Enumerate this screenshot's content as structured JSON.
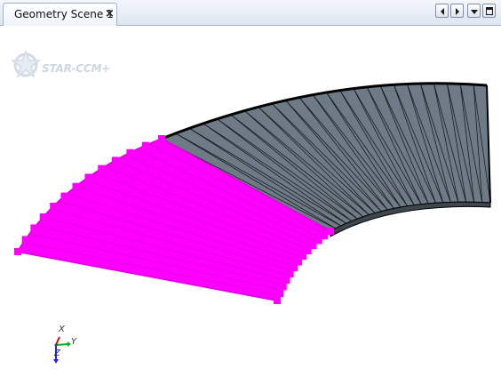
{
  "tab": {
    "title": "Geometry Scene 1",
    "close_glyph": "×"
  },
  "toolbar": {
    "icons": [
      "scroll-left-icon",
      "scroll-right-icon",
      "dropdown-icon",
      "maximize-icon"
    ]
  },
  "viewport": {
    "logo_text": "STAR-CCM+",
    "triad": {
      "x_label": "X",
      "y_label": "Y",
      "z_label": "Z"
    }
  },
  "colors": {
    "selected_part": "#ff00ff",
    "surface_part": "#6e7b87",
    "edge": "#000000",
    "logo": "#cdd6e4"
  }
}
